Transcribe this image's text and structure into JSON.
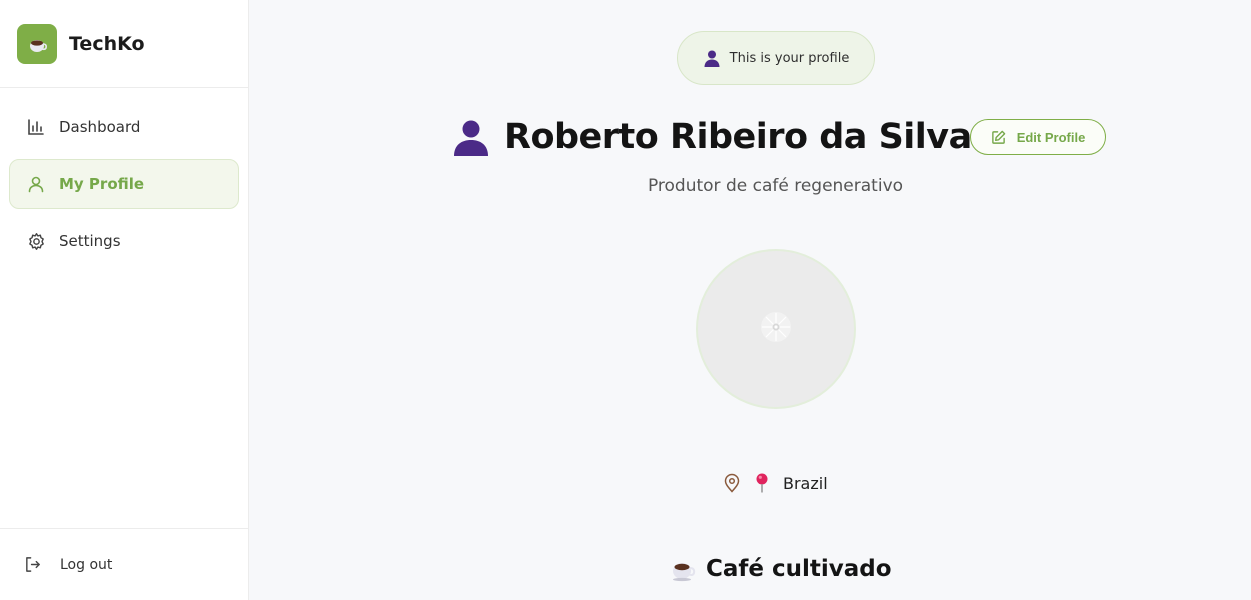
{
  "brand": {
    "name": "TechKo",
    "logo_icon": "coffee-cup-icon",
    "accent": "#7fae47"
  },
  "sidebar": {
    "items": [
      {
        "label": "Dashboard",
        "icon": "bar-chart-icon",
        "active": false
      },
      {
        "label": "My Profile",
        "icon": "user-icon",
        "active": true
      },
      {
        "label": "Settings",
        "icon": "gear-icon",
        "active": false
      }
    ],
    "logout_label": "Log out"
  },
  "profile": {
    "banner": "This is your profile",
    "name": "Roberto Ribeiro da Silva",
    "edit_label": "Edit Profile",
    "subtitle": "Produtor de café regenerativo",
    "location": "Brazil"
  },
  "section": {
    "title": "Café cultivado"
  },
  "colors": {
    "accent": "#7fae47",
    "accent_text": "#76a84a",
    "person_emoji": "#4b2a87"
  }
}
